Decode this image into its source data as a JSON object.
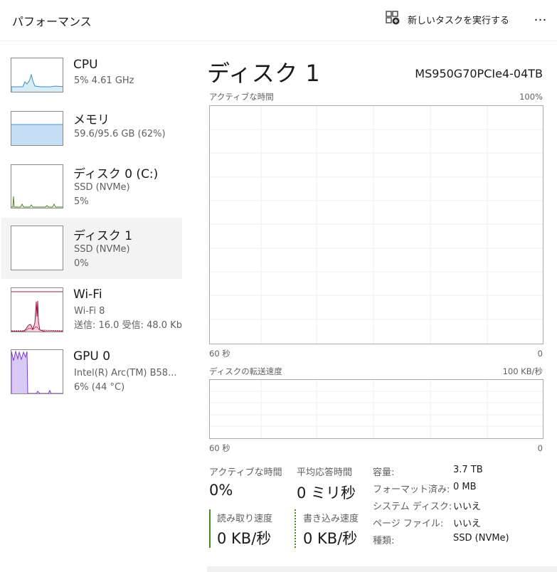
{
  "app": {
    "title": "パフォーマンス",
    "new_task": "新しいタスクを実行する",
    "more": "…"
  },
  "sidebar": {
    "items": [
      {
        "name": "CPU",
        "line1": "5%  4.61 GHz",
        "line2": "",
        "line3": ""
      },
      {
        "name": "メモリ",
        "line1": "59.6/95.6 GB (62%)",
        "line2": "",
        "line3": ""
      },
      {
        "name": "ディスク 0 (C:)",
        "line1": "SSD (NVMe)",
        "line2": "5%",
        "line3": ""
      },
      {
        "name": "ディスク 1",
        "line1": "SSD (NVMe)",
        "line2": "0%",
        "line3": ""
      },
      {
        "name": "Wi-Fi",
        "line1": "Wi-Fi 8",
        "line2": "送信: 16.0  受信: 48.0 Kb",
        "line3": ""
      },
      {
        "name": "GPU 0",
        "line1": "Intel(R) Arc(TM) B58...",
        "line2": "6% (44 °C)",
        "line3": ""
      }
    ]
  },
  "main": {
    "title": "ディスク 1",
    "model": "MS950G70PCIe4-04TB",
    "graph1": {
      "label": "アクティブな時間",
      "max": "100%",
      "time": "60 秒",
      "min": "0"
    },
    "graph2": {
      "label": "ディスクの転送速度",
      "max": "100 KB/秒",
      "time": "60 秒",
      "min": "0"
    },
    "stats": {
      "active_label": "アクティブな時間",
      "active_value": "0%",
      "resp_label": "平均応答時間",
      "resp_value": "0 ミリ秒",
      "read_label": "読み取り速度",
      "read_value": "0 KB/秒",
      "write_label": "書き込み速度",
      "write_value": "0 KB/秒"
    },
    "props": [
      {
        "k": "容量:",
        "v": "3.7 TB"
      },
      {
        "k": "フォーマット済み:",
        "v": "0 MB"
      },
      {
        "k": "システム ディスク:",
        "v": "いいえ"
      },
      {
        "k": "ページ ファイル:",
        "v": "いいえ"
      },
      {
        "k": "種類:",
        "v": "SSD (NVMe)"
      }
    ]
  },
  "colors": {
    "cpu": "#3c8fc2",
    "cpu_fill": "#d8ecf6",
    "mem": "#4a8ccf",
    "mem_fill": "#c7dff5",
    "disk": "#4b8a1e",
    "wifi": "#a3144b",
    "gpu": "#7a3fd0",
    "gpu_fill": "#d9c9f5",
    "read_bar": "#4b8a1e",
    "grid": "#ececec"
  },
  "icons": {
    "new_task": "add-task-icon",
    "more": "more-dots-icon"
  }
}
